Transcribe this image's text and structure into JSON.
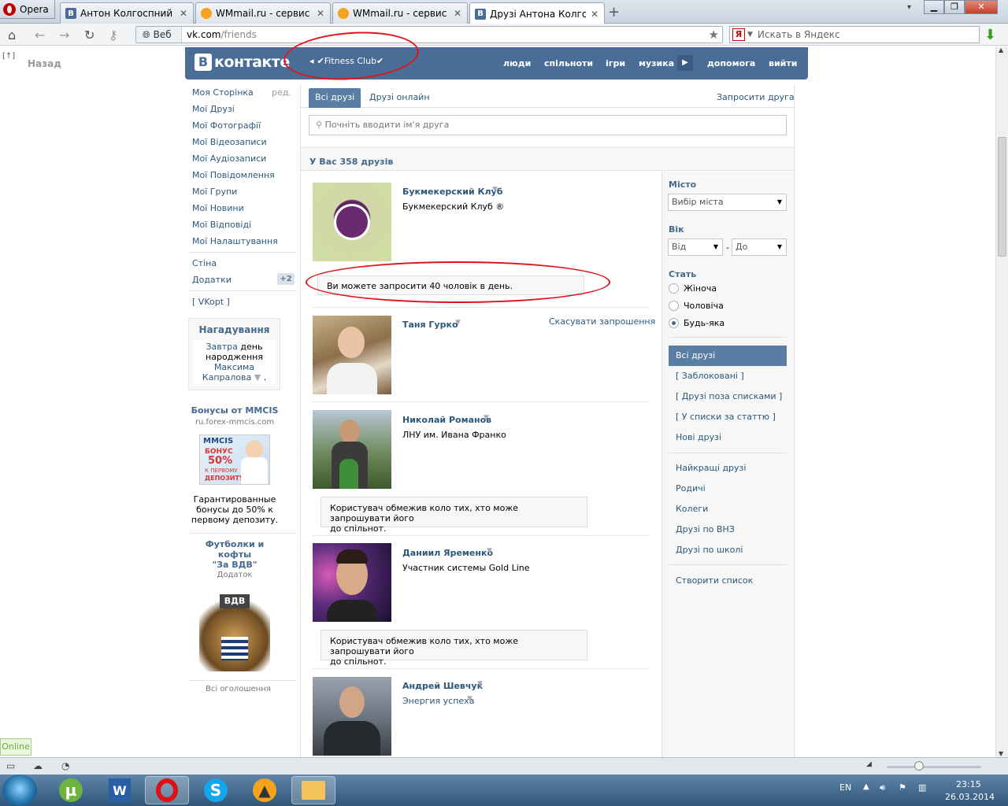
{
  "browser": {
    "menu_label": "Opera",
    "tabs": [
      {
        "title": "Антон Колгоспний",
        "favicon": "vk-icon"
      },
      {
        "title": "WMmail.ru - сервис п...",
        "favicon": "wmmail-icon"
      },
      {
        "title": "WMmail.ru - сервис п...",
        "favicon": "wmmail-icon"
      },
      {
        "title": "Друзі Антона Колгосп...",
        "favicon": "vk-icon"
      }
    ],
    "search_mode": "Веб",
    "url_host": "vk.com",
    "url_path": "/friends",
    "search_placeholder": "Искать в Яндекс",
    "back_label": "Назад",
    "status_online": "Online"
  },
  "vk": {
    "logo_text": "контакте",
    "status": "✔Fitness Club✔",
    "nav": [
      "люди",
      "спільноти",
      "ігри",
      "музика",
      "допомога",
      "вийти"
    ],
    "menu": [
      "Моя Сторінка",
      "Мої Друзі",
      "Мої Фотографії",
      "Мої Відеозаписи",
      "Мої Аудіозаписи",
      "Мої Повідомлення",
      "Мої Групи",
      "Мої Новини",
      "Мої Відповіді",
      "Мої Налаштування"
    ],
    "edit_label": "ред.",
    "menu2": [
      "Стіна",
      "Додатки"
    ],
    "apps_badge": "+2",
    "vkopt": "[ VKopt ]",
    "reminder": {
      "title": "Нагадування",
      "line1_link": "Завтра",
      "line1_text": "день",
      "line2": "народження",
      "name1": "Максима",
      "name2": "Капралова",
      "dot": "."
    },
    "ad1": {
      "title": "Бонусы от MMCIS",
      "domain": "ru.forex-mmcis.com",
      "img_brand": "MMCIS",
      "img_l1": "БОНУС",
      "img_l2": "50%",
      "img_l3": "К ПЕРВОМУ",
      "img_l4": "ДЕПОЗИТУ",
      "text1": "Гарантированные",
      "text2": "бонусы до 50% к",
      "text3": "первому депозиту."
    },
    "ad2": {
      "title1": "Футболки и кофты",
      "title2": "\"За ВДВ\"",
      "sub": "Додаток",
      "img_text": "ВДВ"
    },
    "all_ads": "Всі оголошення"
  },
  "friends": {
    "tab_all": "Всі друзі",
    "tab_online": "Друзі онлайн",
    "invite": "Запросити друга",
    "search_placeholder": "Почніть вводити ім'я друга",
    "count_text": "У Вас 358 друзів",
    "list": [
      {
        "name": "Букмекерский Клуб",
        "sub": "Букмекерский Клуб ®",
        "photo": "club-logo"
      },
      {
        "name": "Таня Гурко",
        "sub": "",
        "photo": "woman-portrait"
      },
      {
        "name": "Николай Романов",
        "sub": "ЛНУ им. Ивана Франко",
        "photo": "man-with-child"
      },
      {
        "name": "Даниил Яременко",
        "sub": "Участник системы Gold Line",
        "photo": "man-portrait"
      },
      {
        "name": "Андрей Шевчук",
        "sub": "Энергия успеха",
        "photo": "man-suit"
      }
    ],
    "limit_notice": "Ви можете запросити 40 чоловік в день.",
    "cancel_request": "Скасувати запрошення",
    "restricted_l1": "Користувач обмежив коло тих, хто може запрошувати його",
    "restricted_l2": "до спільнот."
  },
  "filter": {
    "city_label": "Місто",
    "city_value": "Вибір міста",
    "age_label": "Вік",
    "age_from": "Від",
    "age_dash": "-",
    "age_to": "До",
    "sex_label": "Стать",
    "sex_options": [
      "Жіноча",
      "Чоловіча",
      "Будь-яка"
    ],
    "sex_selected": 2,
    "sections": [
      "Всі друзі",
      "[ Заблоковані ]",
      "[ Друзі поза списками ]",
      "[ У списки за статтю ]",
      "Нові друзі"
    ],
    "lists": [
      "Найкращі друзі",
      "Родичі",
      "Колеги",
      "Друзі по ВНЗ",
      "Друзі по школі"
    ],
    "create": "Створити список"
  },
  "taskbar": {
    "lang": "EN",
    "time": "23:15",
    "date": "26.03.2014"
  },
  "colors": {
    "vk_blue": "#4a6d98",
    "vk_link": "#2b587a",
    "annotation_red": "#e0141b"
  }
}
